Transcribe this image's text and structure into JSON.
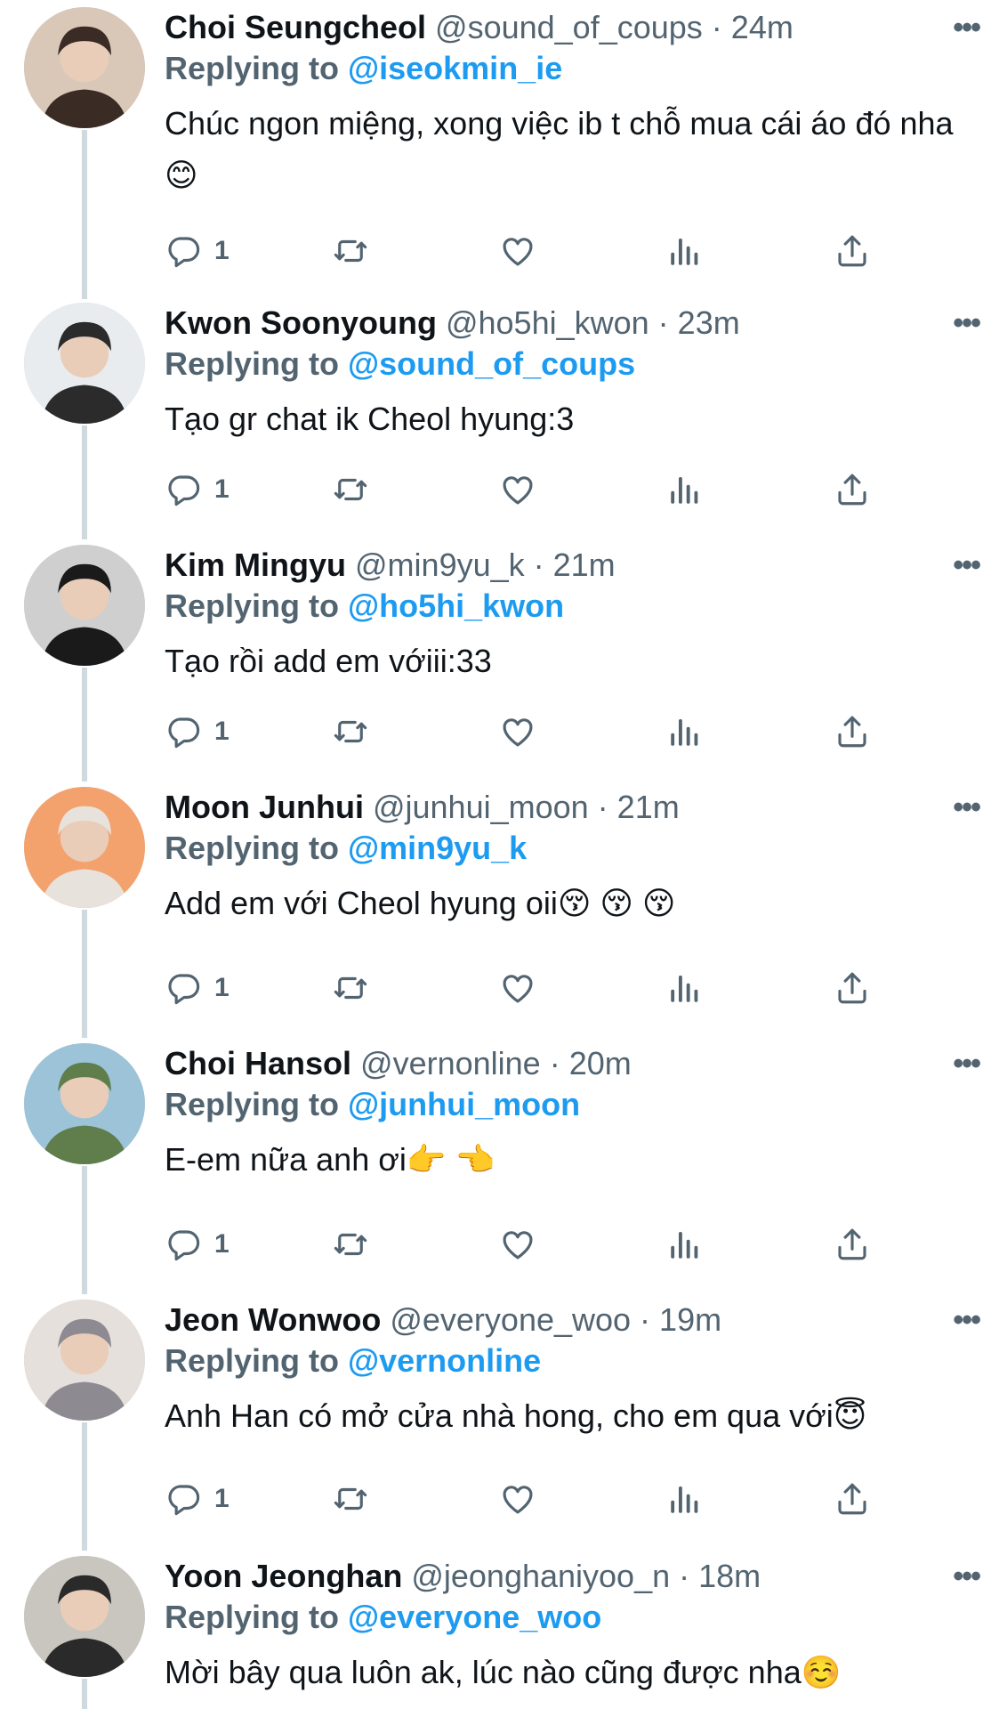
{
  "colors": {
    "accent": "#1d9bf0",
    "muted": "#536471",
    "text": "#0f1419",
    "thread_line": "#cfd9de"
  },
  "icons": {
    "reply": "reply-icon",
    "retweet": "retweet-icon",
    "like": "heart-icon",
    "views": "analytics-icon",
    "share": "share-icon",
    "more": "more-icon"
  },
  "reply_prefix": "Replying to",
  "tweets": [
    {
      "name": "Choi Seungcheol",
      "handle": "@sound_of_coups",
      "time": "24m",
      "reply_to": "@iseokmin_ie",
      "text": "Chúc ngon miệng, xong việc ib t chỗ mua cái áo đó nha😊",
      "reply_count": "1"
    },
    {
      "name": "Kwon Soonyoung",
      "handle": "@ho5hi_kwon",
      "time": "23m",
      "reply_to": "@sound_of_coups",
      "text": "Tạo gr chat ik Cheol hyung:3",
      "reply_count": "1"
    },
    {
      "name": "Kim Mingyu",
      "handle": "@min9yu_k",
      "time": "21m",
      "reply_to": "@ho5hi_kwon",
      "text": "Tạo rồi add em vớiii:33",
      "reply_count": "1"
    },
    {
      "name": "Moon Junhui",
      "handle": "@junhui_moon",
      "time": "21m",
      "reply_to": "@min9yu_k",
      "text": "Add em với Cheol hyung oii😚 😚 😚",
      "reply_count": "1"
    },
    {
      "name": "Choi Hansol",
      "handle": "@vernonline",
      "time": "20m",
      "reply_to": "@junhui_moon",
      "text": "E-em nữa anh ơi👉 👈",
      "reply_count": "1"
    },
    {
      "name": "Jeon Wonwoo",
      "handle": "@everyone_woo",
      "time": "19m",
      "reply_to": "@vernonline",
      "text": "Anh Han có mở cửa nhà hong, cho em qua với😇",
      "reply_count": "1"
    },
    {
      "name": "Yoon Jeonghan",
      "handle": "@jeonghaniyoo_n",
      "time": "18m",
      "reply_to": "@everyone_woo",
      "text": "Mời bây qua luôn ak, lúc nào cũng được nha☺️",
      "reply_count": ""
    }
  ]
}
